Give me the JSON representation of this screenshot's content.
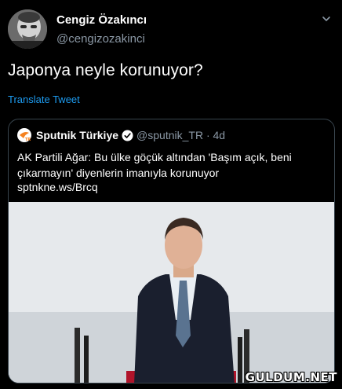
{
  "author": {
    "name": "Cengiz Özakıncı",
    "handle": "@cengizozakinci"
  },
  "tweet": {
    "text": "Japonya neyle korunuyor?",
    "translate_label": "Translate Tweet"
  },
  "quoted": {
    "name": "Sputnik Türkiye",
    "handle_time": "@sputnik_TR · 4d",
    "text": "AK Partili Ağar: Bu ülke göçük altından 'Başım açık, beni çıkarmayın' diyenlerin imanıyla korunuyor",
    "link": "sptnkne.ws/Brcq"
  },
  "watermark": "GULDUM.NET",
  "colors": {
    "background": "#000000",
    "link_blue": "#1d9bf0",
    "secondary_text": "#8b98a5",
    "border": "#38444d",
    "sputnik_orange": "#f5821f"
  },
  "icons": {
    "caret": "chevron-down-icon",
    "verified": "verified-badge-icon",
    "logo": "sputnik-logo-icon"
  }
}
